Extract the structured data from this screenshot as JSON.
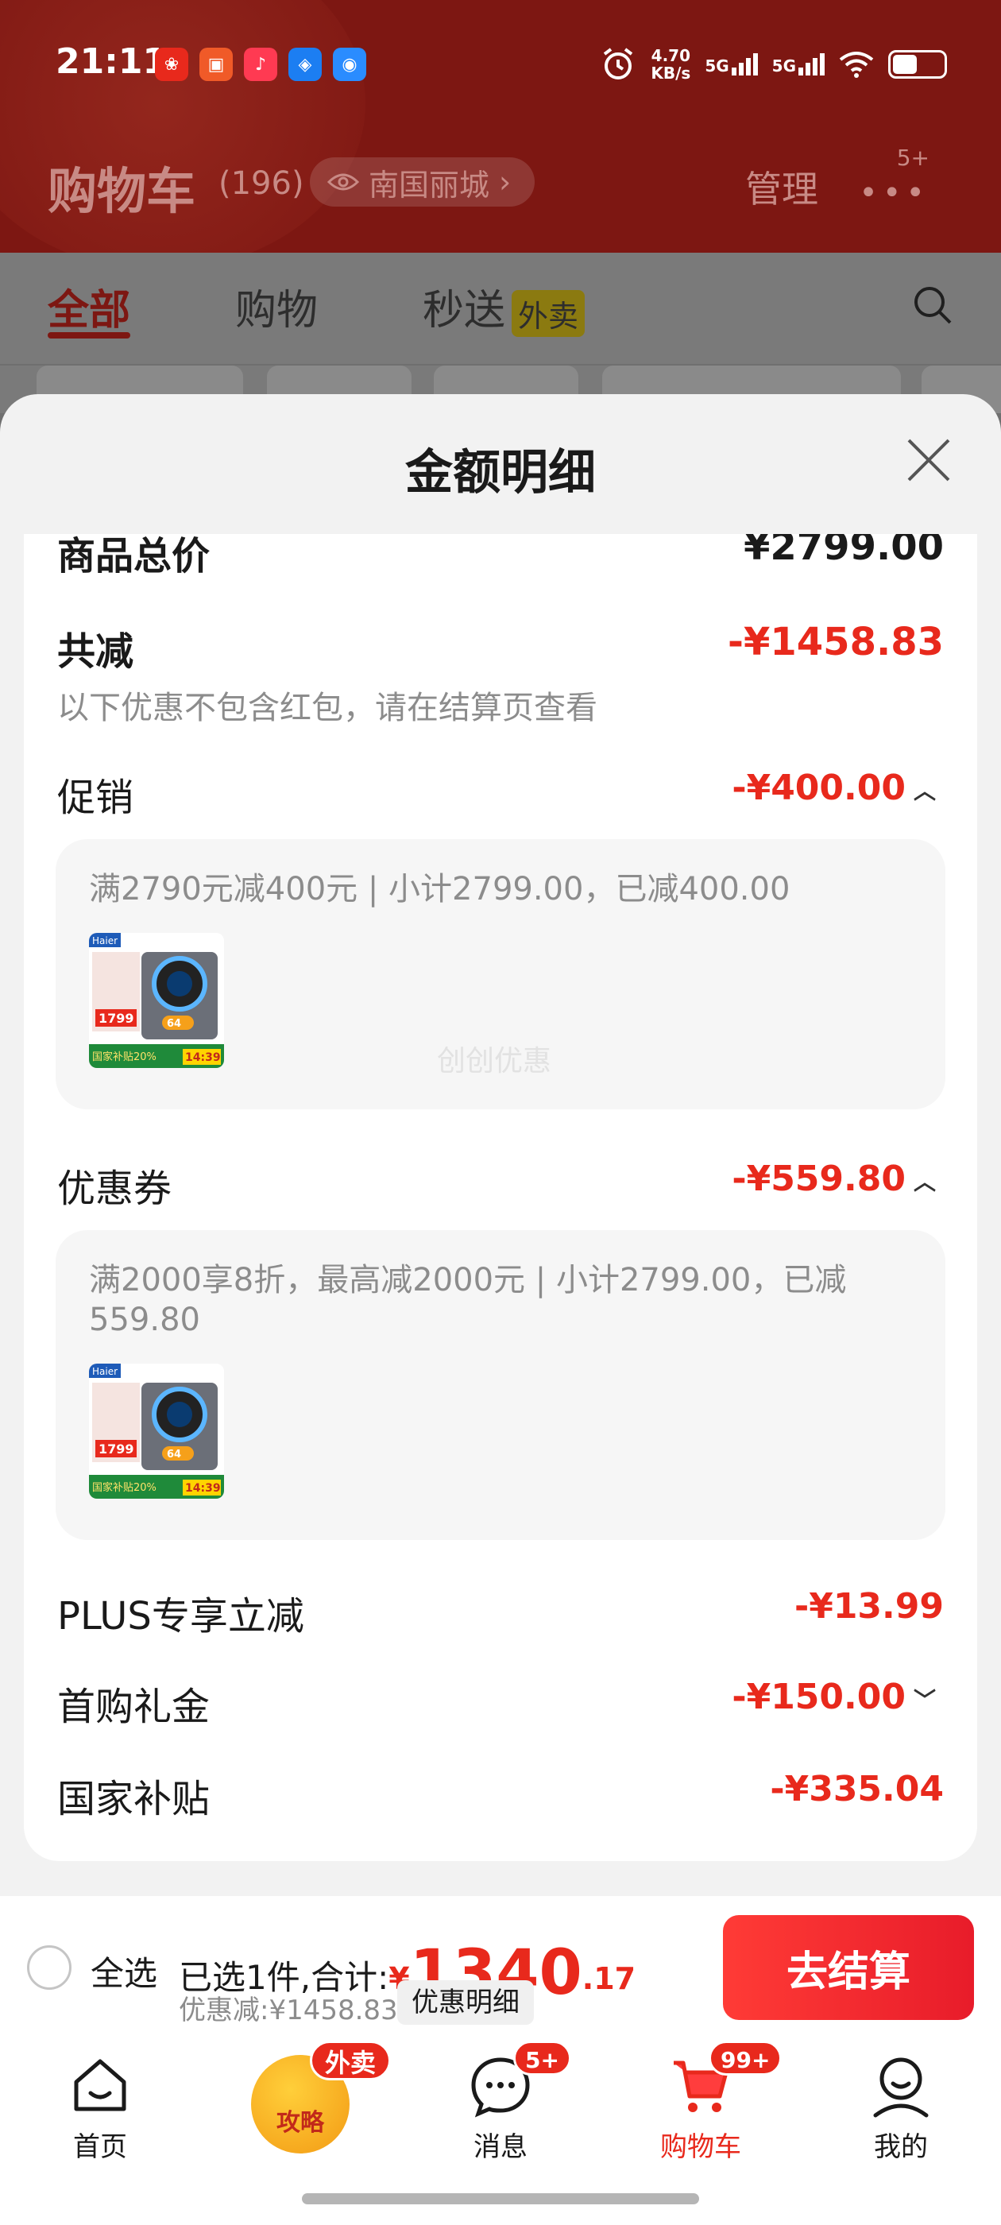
{
  "status_bar": {
    "time": "21:11",
    "net_speed_value": "4.70",
    "net_speed_unit": "KB/s",
    "signal1_label": "5G",
    "signal2_label": "5G"
  },
  "header": {
    "title": "购物车",
    "count": "(196)",
    "location": "南国丽城",
    "manage": "管理",
    "more_badge": "5+"
  },
  "tabs": [
    {
      "label": "全部"
    },
    {
      "label": "购物"
    },
    {
      "label": "秒送",
      "tag": "外卖"
    }
  ],
  "sheet": {
    "title": "金额明细",
    "rows": {
      "goods_total": {
        "label": "商品总价",
        "value": "¥2799.00"
      },
      "total_reduction": {
        "label": "共减",
        "value": "-¥1458.83",
        "note": "以下优惠不包含红包，请在结算页查看"
      },
      "promotion": {
        "label": "促销",
        "value": "-¥400.00"
      },
      "coupon": {
        "label": "优惠券",
        "value": "-¥559.80"
      },
      "plus": {
        "label": "PLUS专享立减",
        "value": "-¥13.99"
      },
      "first_purchase": {
        "label": "首购礼金",
        "value": "-¥150.00"
      },
      "national_subsidy": {
        "label": "国家补贴",
        "value": "-¥335.04"
      }
    },
    "promotion_detail": {
      "text": "满2790元减400元 | 小计2799.00，已减400.00",
      "watermark": "创创优惠"
    },
    "coupon_detail": {
      "text": "满2000享8折，最高减2000元 | 小计2799.00，已减559.80"
    },
    "thumb": {
      "brand": "Haier",
      "price": "1799",
      "subsidy": "国家补贴20%",
      "badge": "64",
      "time": "14:39"
    }
  },
  "checkout": {
    "select_all": "全选",
    "selected_prefix": "已选1件,合计:",
    "currency": "¥",
    "total_int": "1340",
    "total_dec": ".17",
    "discount": "优惠减:¥1458.83",
    "detail_button": "优惠明细",
    "checkout_button": "去结算"
  },
  "nav": {
    "items": [
      {
        "label": "首页"
      },
      {
        "label": "消息",
        "badge": "5+"
      },
      {
        "label": "购物车",
        "badge": "99+"
      },
      {
        "label": "我的"
      }
    ],
    "promo_label": "攻略",
    "promo_badge": "外卖"
  },
  "colors": {
    "accent_red": "#e8291c",
    "header_dark_red": "#7d1712"
  }
}
